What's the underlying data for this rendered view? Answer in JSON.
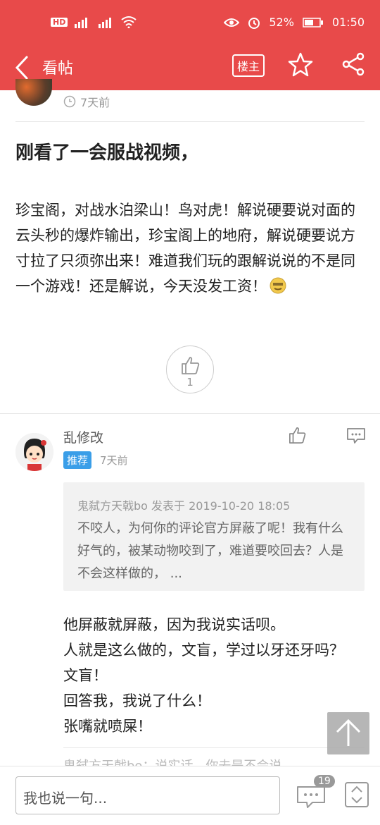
{
  "status_bar": {
    "battery_pct": "52%",
    "time": "01:50",
    "hd_label": "HD"
  },
  "appbar": {
    "title": "看帖",
    "owner_label": "楼主"
  },
  "post": {
    "author_time": "7天前",
    "title": "刚看了一会服战视频，",
    "body": "珍宝阁，对战水泊梁山！鸟对虎！解说硬要说对面的云头秒的爆炸输出，珍宝阁上的地府，解说硬要说方寸拉了只须弥出来！难道我们玩的跟解说说的不是同一个游戏！还是解说，今天没发工资！",
    "like_count": "1"
  },
  "comment": {
    "username": "乱修改",
    "badge": "推荐",
    "time": "7天前",
    "quote_meta": "鬼弑方天戟bo 发表于 2019-10-20 18:05",
    "quote_text": "不咬人，为何你的评论官方屏蔽了呢！我有什么好气的，被某动物咬到了，难道要咬回去？人是不会这样做的，  ...",
    "reply_text": "他屏蔽就屏蔽，因为我说实话呗。\n人就是这么做的，文盲，学过以牙还牙吗？ 文盲！\n回答我，我说了什么！\n张嘴就喷屎！",
    "next_snippet": "鬼弑方天戟bo：说实话，你去是不会说"
  },
  "bottom_bar": {
    "input_placeholder": "我也说一句...",
    "comment_count": "19"
  },
  "colors": {
    "brand_red": "#e84a4a",
    "badge_blue": "#3a9ee8"
  }
}
